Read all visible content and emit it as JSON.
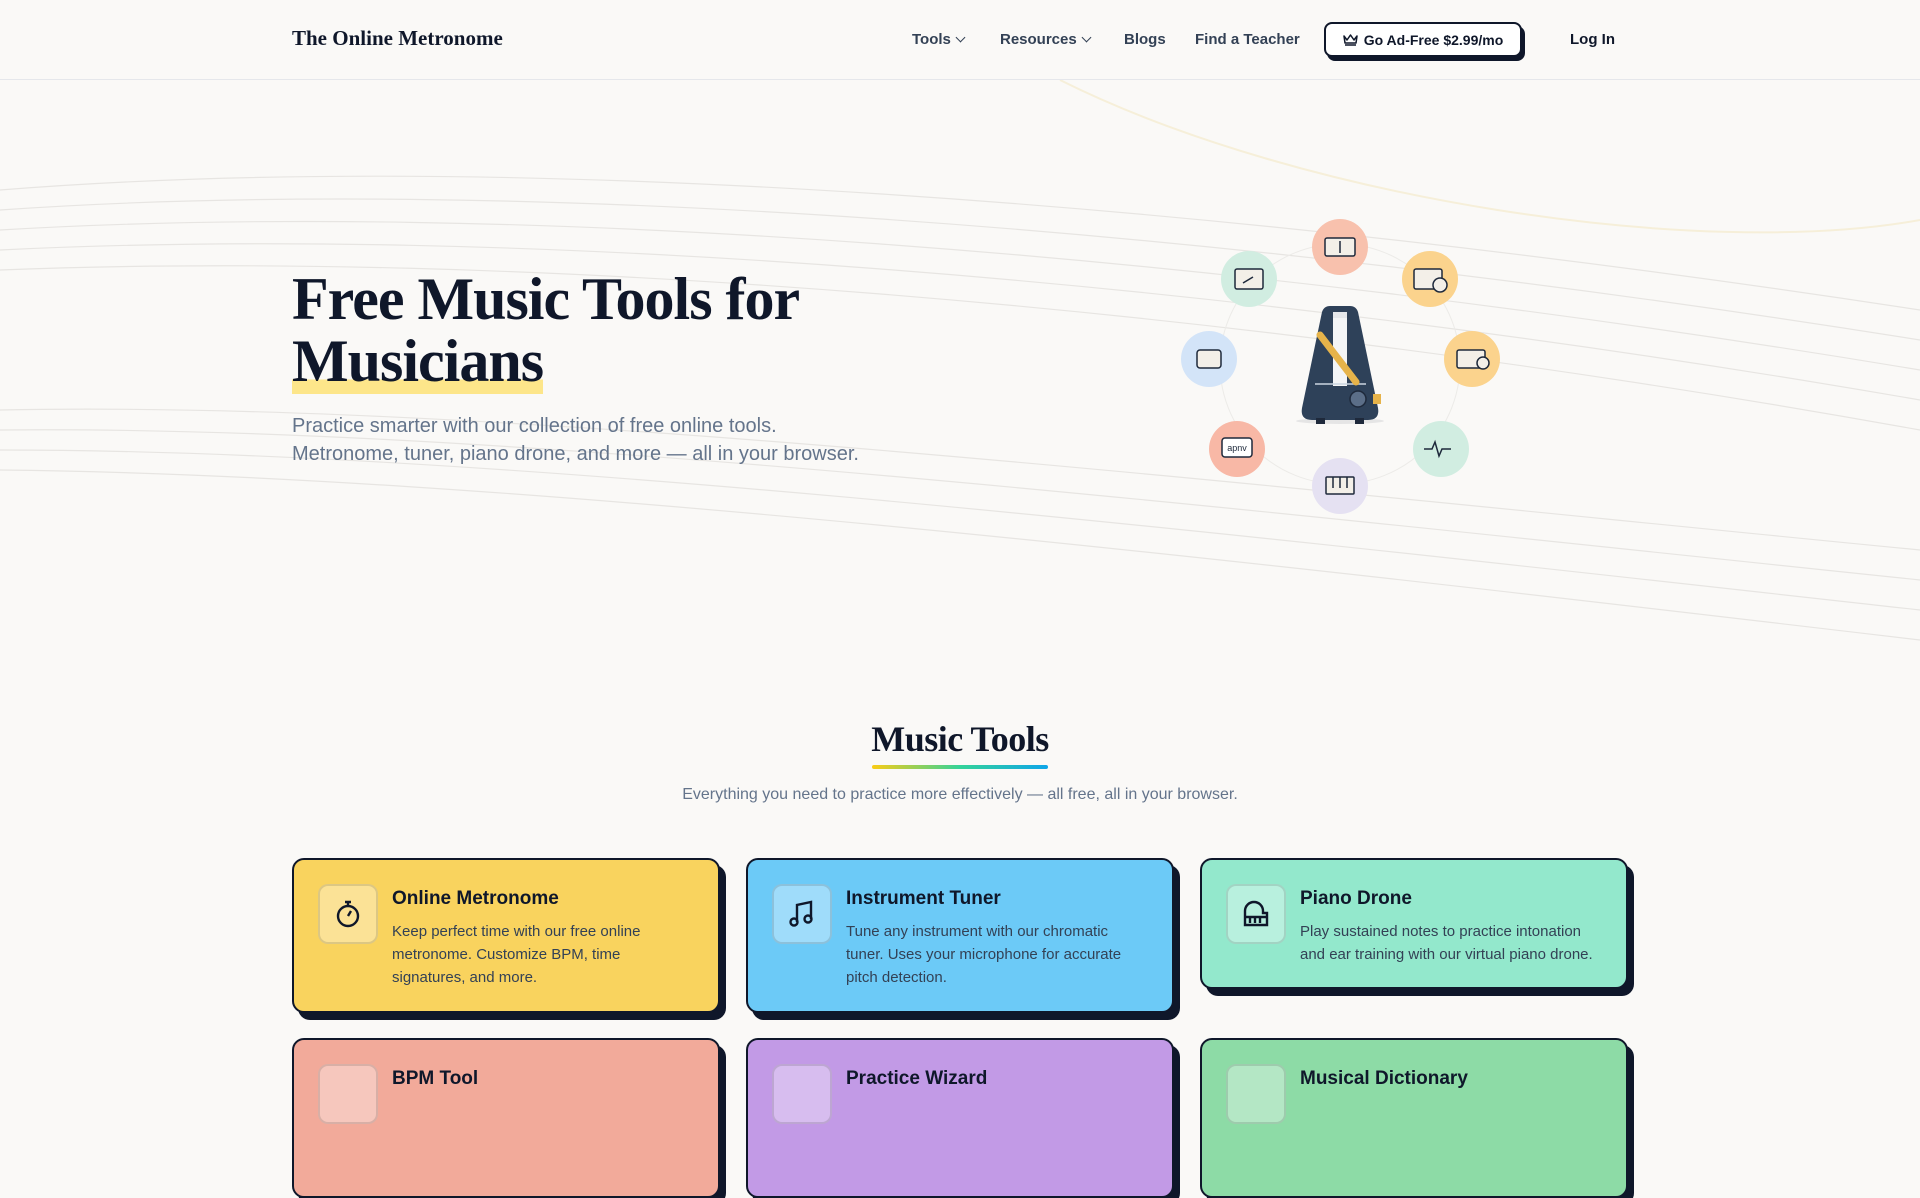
{
  "nav": {
    "logo": "The Online Metronome",
    "items": [
      {
        "label": "Tools"
      },
      {
        "label": "Resources"
      },
      {
        "label": "Blogs"
      },
      {
        "label": "Find a Teacher"
      }
    ],
    "cta": "Go Ad-Free $2.99/mo",
    "login": "Log In"
  },
  "hero": {
    "title_line1": "Free Music Tools for",
    "title_line2": "Musicians",
    "sub_line1": "Practice smarter with our collection of free online tools.",
    "sub_line2": "Metronome, tuner, piano drone, and more — all in your browser.",
    "badge_text": "apnv"
  },
  "section": {
    "title": "Music Tools",
    "subtitle": "Everything you need to practice more effectively — all free, all in your browser."
  },
  "cards": [
    {
      "title": "Online Metronome",
      "desc": "Keep perfect time with our free online metronome. Customize BPM, time signatures, and more.",
      "color": "#f9d35e",
      "icon": "stopwatch-icon"
    },
    {
      "title": "Instrument Tuner",
      "desc": "Tune any instrument with our chromatic tuner. Uses your microphone for accurate pitch detection.",
      "color": "#6ccaf7",
      "icon": "music-note-icon"
    },
    {
      "title": "Piano Drone",
      "desc": "Play sustained notes to practice intonation and ear training with our virtual piano drone.",
      "color": "#93e8cc",
      "icon": "piano-icon"
    },
    {
      "title": "BPM Tool",
      "desc": "",
      "color": "#f2aa9a",
      "icon": "bpm-icon"
    },
    {
      "title": "Practice Wizard",
      "desc": "",
      "color": "#c29ae6",
      "icon": "wizard-icon"
    },
    {
      "title": "Musical Dictionary",
      "desc": "",
      "color": "#8ddba6",
      "icon": "book-icon"
    }
  ]
}
